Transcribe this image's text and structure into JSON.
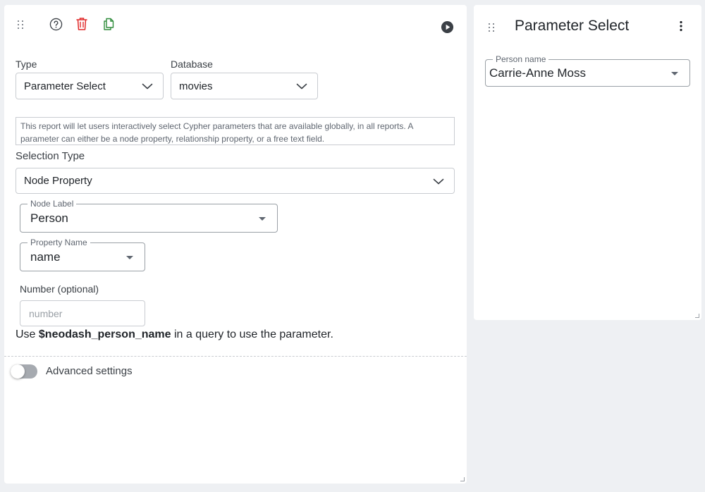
{
  "settings": {
    "type": {
      "label": "Type",
      "value": "Parameter Select"
    },
    "database": {
      "label": "Database",
      "value": "movies"
    },
    "description": "This report will let users interactively select Cypher parameters that are available globally, in all reports. A parameter can either be a node property, relationship property, or a free text field.",
    "selection_type": {
      "label": "Selection Type",
      "value": "Node Property"
    },
    "node_label": {
      "legend": "Node Label",
      "value": "Person"
    },
    "property_name": {
      "legend": "Property Name",
      "value": "name"
    },
    "number": {
      "label": "Number (optional)",
      "placeholder": "number"
    },
    "usage": {
      "prefix": "Use ",
      "param": "$neodash_person_name",
      "suffix": " in a query to use the parameter."
    },
    "advanced": {
      "label": "Advanced settings",
      "enabled": false
    }
  },
  "report": {
    "title": "Parameter Select",
    "field": {
      "legend": "Person name",
      "value": "Carrie-Anne Moss"
    }
  },
  "icons": {
    "drag": "drag-handle-icon",
    "help": "help-circle-icon",
    "delete": "trash-icon",
    "copy": "copy-icon",
    "run": "play-circle-icon",
    "more": "more-vertical-icon"
  },
  "colors": {
    "delete": "#e02828",
    "copy": "#2e8b3a",
    "run": "#3b4046"
  }
}
